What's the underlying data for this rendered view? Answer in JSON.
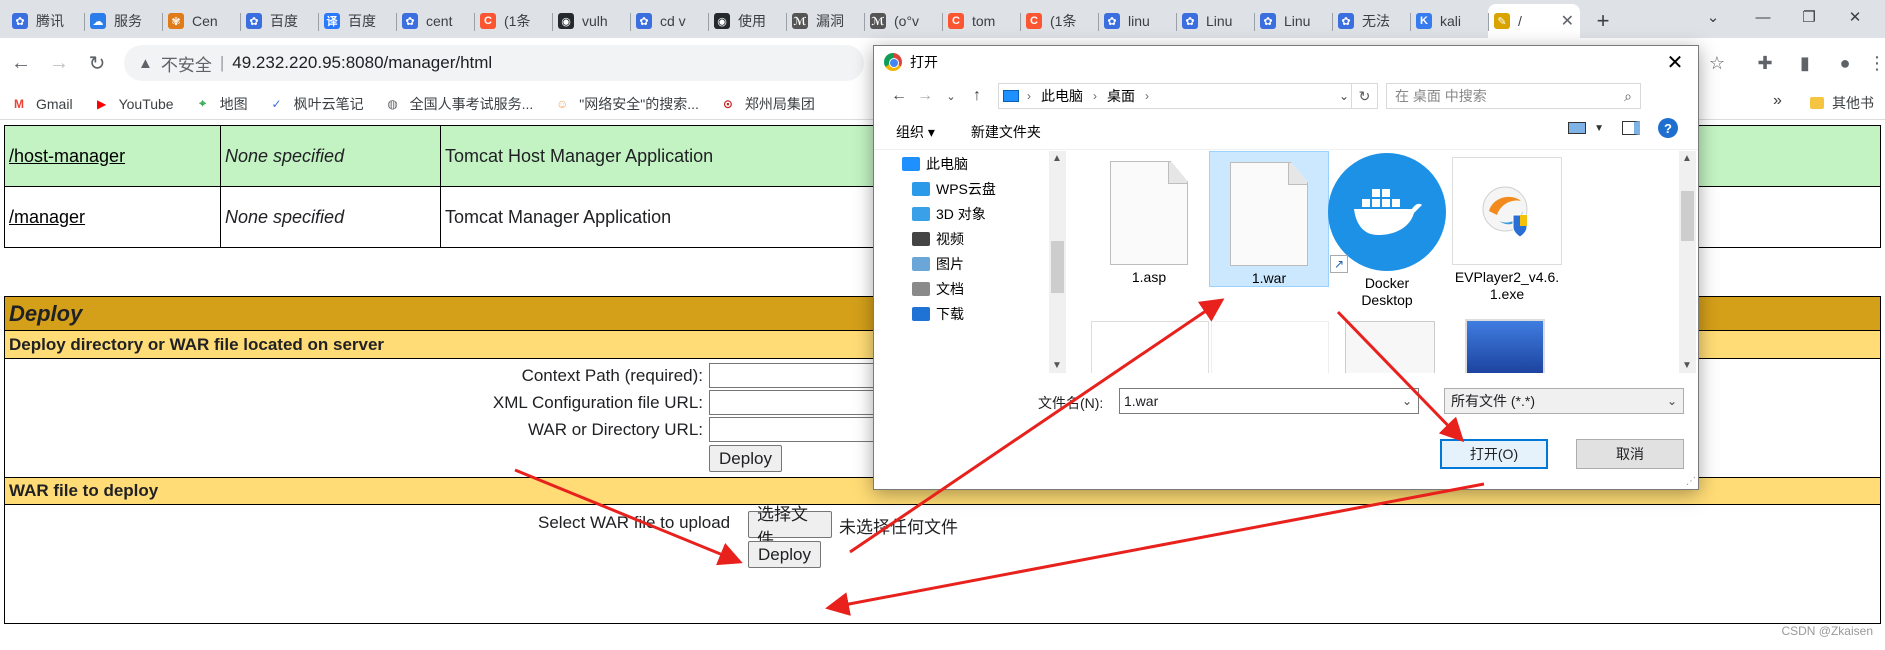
{
  "browser": {
    "tabs": [
      {
        "label": "腾讯",
        "icon": "paw-icon"
      },
      {
        "label": "服务",
        "icon": "cloud-icon"
      },
      {
        "label": "Cen",
        "icon": "flower-icon"
      },
      {
        "label": "百度",
        "icon": "paw-icon"
      },
      {
        "label": "百度",
        "icon": "translate-icon"
      },
      {
        "label": "cent",
        "icon": "paw-icon"
      },
      {
        "label": "(1条",
        "icon": "csdn-icon"
      },
      {
        "label": "vulh",
        "icon": "github-icon"
      },
      {
        "label": "cd v",
        "icon": "paw-icon"
      },
      {
        "label": "使用",
        "icon": "github-icon"
      },
      {
        "label": "漏洞",
        "icon": "vuln-icon"
      },
      {
        "label": "(o°v",
        "icon": "vuln-icon"
      },
      {
        "label": "tom",
        "icon": "csdn-icon"
      },
      {
        "label": "(1条",
        "icon": "csdn-icon"
      },
      {
        "label": "linu",
        "icon": "paw-icon"
      },
      {
        "label": "Linu",
        "icon": "paw-icon"
      },
      {
        "label": "Linu",
        "icon": "paw-icon"
      },
      {
        "label": "无法",
        "icon": "paw-icon"
      },
      {
        "label": "kali",
        "icon": "kali-icon"
      },
      {
        "label": "/",
        "icon": "tomcat-icon"
      }
    ],
    "new_tab_label": "+",
    "address": {
      "insecure_label": "不安全",
      "separator": "|",
      "url": "49.232.220.95:8080/manager/html"
    },
    "bookmarks": [
      {
        "label": "Gmail",
        "icon": "gmail-icon",
        "color": "#ea4335"
      },
      {
        "label": "YouTube",
        "icon": "youtube-icon",
        "color": "#ff0000"
      },
      {
        "label": "地图",
        "icon": "maps-icon",
        "color": "#34a853"
      },
      {
        "label": "枫叶云笔记",
        "icon": "note-icon",
        "color": "#3b6fe0"
      },
      {
        "label": "全国人事考试服务...",
        "icon": "globe-icon",
        "color": "#5f6368"
      },
      {
        "label": "\"网络安全\"的搜索...",
        "icon": "avatar-icon",
        "color": "#f6a25c"
      },
      {
        "label": "郑州局集团",
        "icon": "rail-icon",
        "color": "#c5221f"
      }
    ],
    "bookmarks_more": "»",
    "other_bookmarks": "其他书"
  },
  "page": {
    "apps": [
      {
        "path": "/host-manager",
        "version": "None specified",
        "display_name": "Tomcat Host Manager Application",
        "bg": "#c3f3c3"
      },
      {
        "path": "/manager",
        "version": "None specified",
        "display_name": "Tomcat Manager Application",
        "bg": "#ffffff"
      }
    ],
    "deploy": {
      "title": "Deploy",
      "server_section": "Deploy directory or WAR file located on server",
      "context_path_label": "Context Path (required):",
      "xml_config_label": "XML Configuration file URL:",
      "war_dir_label": "WAR or Directory URL:",
      "deploy_button": "Deploy",
      "war_section": "WAR file to deploy",
      "select_war_label": "Select WAR file to upload",
      "choose_file_button": "选择文件",
      "no_file_text": "未选择任何文件",
      "upload_deploy_button": "Deploy"
    }
  },
  "dialog": {
    "title": "打开",
    "breadcrumb": [
      "此电脑",
      "桌面"
    ],
    "search_placeholder": "在 桌面 中搜索",
    "organize": "组织 ▾",
    "new_folder": "新建文件夹",
    "tree": [
      {
        "label": "此电脑",
        "icon": "computer-icon",
        "color": "#1e90ff"
      },
      {
        "label": "WPS云盘",
        "icon": "wps-cloud-icon",
        "color": "#2b9be9"
      },
      {
        "label": "3D 对象",
        "icon": "3d-objects-icon",
        "color": "#3aa0e8"
      },
      {
        "label": "视频",
        "icon": "video-icon",
        "color": "#444444"
      },
      {
        "label": "图片",
        "icon": "pictures-icon",
        "color": "#6aa6d8"
      },
      {
        "label": "文档",
        "icon": "documents-icon",
        "color": "#8a8a8a"
      },
      {
        "label": "下载",
        "icon": "download-icon",
        "color": "#1e73d4"
      }
    ],
    "files": [
      {
        "name": "1.asp",
        "icon": "blank-file-icon",
        "selected": false
      },
      {
        "name": "1.war",
        "icon": "blank-file-icon",
        "selected": true
      },
      {
        "name": "Docker Desktop",
        "icon": "docker-icon",
        "selected": false
      },
      {
        "name": "EVPlayer2_v4.6.1.exe",
        "icon": "evplayer-icon",
        "selected": false
      }
    ],
    "filename_label": "文件名(N):",
    "filename_value": "1.war",
    "filetype_value": "所有文件 (*.*)",
    "open_button": "打开(O)",
    "cancel_button": "取消"
  },
  "watermark": "CSDN @Zkaisen",
  "colors": {
    "tomcat_green_row": "#c3f3c3",
    "deploy_header": "#d4a01a",
    "deploy_subheader": "#ffdc75",
    "arrow_red": "#e8211d",
    "selection_blue": "#cce8ff"
  }
}
